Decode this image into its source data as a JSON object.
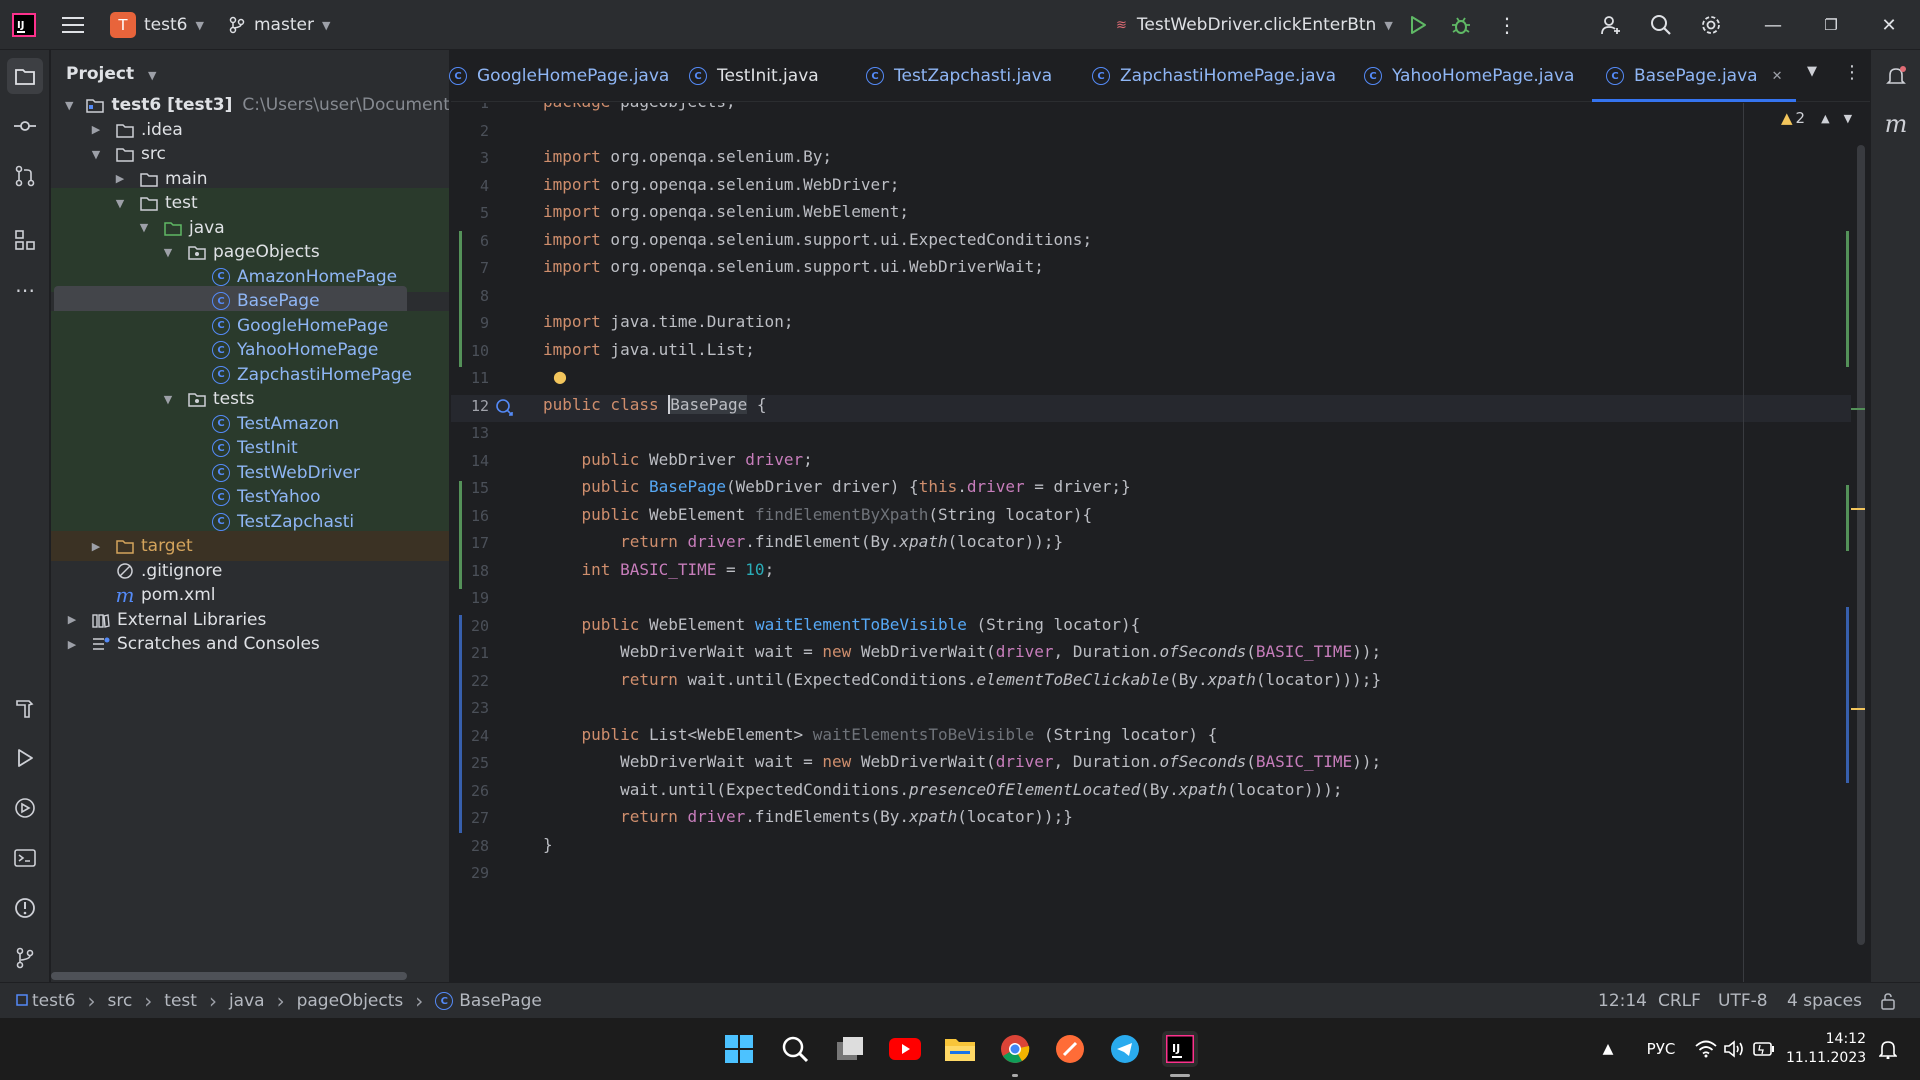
{
  "titlebar": {
    "project_initial": "T",
    "project_name": "test6",
    "branch": "master",
    "run_config": "TestWebDriver.clickEnterBtn"
  },
  "project_panel": {
    "title": "Project",
    "tree": [
      {
        "label": "test6 [test3]",
        "suffix": "C:\\Users\\user\\Documents\\te",
        "type": "module",
        "expanded": true,
        "depth": 0
      },
      {
        "label": ".idea",
        "type": "folder",
        "expanded": false,
        "depth": 1
      },
      {
        "label": "src",
        "type": "folder",
        "expanded": true,
        "depth": 1
      },
      {
        "label": "main",
        "type": "folder",
        "expanded": false,
        "depth": 2
      },
      {
        "label": "test",
        "type": "folder",
        "expanded": true,
        "depth": 2
      },
      {
        "label": "java",
        "type": "folder-green",
        "expanded": true,
        "depth": 3
      },
      {
        "label": "pageObjects",
        "type": "package",
        "expanded": true,
        "depth": 4
      },
      {
        "label": "AmazonHomePage",
        "type": "class",
        "depth": 5
      },
      {
        "label": "BasePage",
        "type": "class",
        "depth": 5,
        "selected": true
      },
      {
        "label": "GoogleHomePage",
        "type": "class",
        "depth": 5
      },
      {
        "label": "YahooHomePage",
        "type": "class",
        "depth": 5
      },
      {
        "label": "ZapchastiHomePage",
        "type": "class",
        "depth": 5
      },
      {
        "label": "tests",
        "type": "package",
        "expanded": true,
        "depth": 4
      },
      {
        "label": "TestAmazon",
        "type": "class",
        "depth": 5
      },
      {
        "label": "TestInit",
        "type": "class",
        "depth": 5
      },
      {
        "label": "TestWebDriver",
        "type": "class",
        "depth": 5
      },
      {
        "label": "TestYahoo",
        "type": "class",
        "depth": 5
      },
      {
        "label": "TestZapchasti",
        "type": "class",
        "depth": 5
      },
      {
        "label": "target",
        "type": "folder-orange",
        "expanded": false,
        "depth": 1
      },
      {
        "label": ".gitignore",
        "type": "ignore",
        "depth": 1
      },
      {
        "label": "pom.xml",
        "type": "maven",
        "depth": 1
      },
      {
        "label": "External Libraries",
        "type": "library",
        "expanded": false,
        "depth": 0
      },
      {
        "label": "Scratches and Consoles",
        "type": "scratch",
        "expanded": false,
        "depth": 0
      }
    ]
  },
  "tabs": [
    {
      "label": "GoogleHomePage.java",
      "active": false
    },
    {
      "label": "TestInit.java",
      "active": false
    },
    {
      "label": "TestZapchasti.java",
      "active": false
    },
    {
      "label": "ZapchastiHomePage.java",
      "active": false
    },
    {
      "label": "YahooHomePage.java",
      "active": false
    },
    {
      "label": "BasePage.java",
      "active": true
    }
  ],
  "editor": {
    "warning_count": "2",
    "lines": [
      [
        [
          "package pageObjects;",
          "kw0"
        ]
      ],
      [],
      [
        [
          "import",
          "kw"
        ],
        [
          " org.openqa.selenium.By;",
          ""
        ]
      ],
      [
        [
          "import",
          "kw"
        ],
        [
          " org.openqa.selenium.WebDriver;",
          ""
        ]
      ],
      [
        [
          "import",
          "kw"
        ],
        [
          " org.openqa.selenium.WebElement;",
          ""
        ]
      ],
      [
        [
          "import",
          "kw"
        ],
        [
          " org.openqa.selenium.support.ui.ExpectedConditions;",
          ""
        ]
      ],
      [
        [
          "import",
          "kw"
        ],
        [
          " org.openqa.selenium.support.ui.WebDriverWait;",
          ""
        ]
      ],
      [],
      [
        [
          "import",
          "kw"
        ],
        [
          " java.time.Duration;",
          ""
        ]
      ],
      [
        [
          "import",
          "kw"
        ],
        [
          " java.util.List;",
          ""
        ]
      ],
      [],
      [
        [
          "public class ",
          "kw"
        ],
        [
          "BasePage",
          ""
        ],
        [
          " {",
          ""
        ]
      ],
      [],
      [
        [
          "    public ",
          "kw"
        ],
        [
          "WebDriver ",
          ""
        ],
        [
          "driver",
          "fld"
        ],
        [
          ";",
          ""
        ]
      ],
      [
        [
          "    public ",
          "kw"
        ],
        [
          "BasePage",
          "mth"
        ],
        [
          "(WebDriver driver) {",
          ""
        ],
        [
          "this",
          "kw"
        ],
        [
          ".",
          ""
        ],
        [
          "driver",
          "fld"
        ],
        [
          " = driver;}",
          ""
        ]
      ],
      [
        [
          "    public ",
          "kw"
        ],
        [
          "WebElement ",
          ""
        ],
        [
          "findElementByXpath",
          "gray"
        ],
        [
          "(String locator){",
          ""
        ]
      ],
      [
        [
          "        return ",
          "kw"
        ],
        [
          "driver",
          "fld"
        ],
        [
          ".findElement(By.",
          ""
        ],
        [
          "xpath",
          "it"
        ],
        [
          "(locator));}",
          ""
        ]
      ],
      [
        [
          "    int ",
          "kw"
        ],
        [
          "BASIC_TIME",
          "fld"
        ],
        [
          " = ",
          ""
        ],
        [
          "10",
          "num"
        ],
        [
          ";",
          ""
        ]
      ],
      [],
      [
        [
          "    public ",
          "kw"
        ],
        [
          "WebElement ",
          ""
        ],
        [
          "waitElementToBeVisible",
          "mth"
        ],
        [
          " (String locator){",
          ""
        ]
      ],
      [
        [
          "        WebDriverWait wait = ",
          ""
        ],
        [
          "new ",
          "kw"
        ],
        [
          "WebDriverWait(",
          ""
        ],
        [
          "driver",
          "fld"
        ],
        [
          ", Duration.",
          ""
        ],
        [
          "ofSeconds",
          "it"
        ],
        [
          "(",
          ""
        ],
        [
          "BASIC_TIME",
          "fld"
        ],
        [
          "));",
          ""
        ]
      ],
      [
        [
          "        return ",
          "kw"
        ],
        [
          "wait.until(ExpectedConditions.",
          ""
        ],
        [
          "elementToBeClickable",
          "it"
        ],
        [
          "(By.",
          ""
        ],
        [
          "xpath",
          "it"
        ],
        [
          "(locator)));}",
          ""
        ]
      ],
      [],
      [
        [
          "    public ",
          "kw"
        ],
        [
          "List<WebElement> ",
          ""
        ],
        [
          "waitElementsToBeVisible",
          "gray"
        ],
        [
          " (String locator) {",
          ""
        ]
      ],
      [
        [
          "        WebDriverWait wait = ",
          ""
        ],
        [
          "new ",
          "kw"
        ],
        [
          "WebDriverWait(",
          ""
        ],
        [
          "driver",
          "fld"
        ],
        [
          ", Duration.",
          ""
        ],
        [
          "ofSeconds",
          "it"
        ],
        [
          "(",
          ""
        ],
        [
          "BASIC_TIME",
          "fld"
        ],
        [
          "));",
          ""
        ]
      ],
      [
        [
          "        wait.until(ExpectedConditions.",
          ""
        ],
        [
          "presenceOfElementLocated",
          "it"
        ],
        [
          "(By.",
          ""
        ],
        [
          "xpath",
          "it"
        ],
        [
          "(locator)));",
          ""
        ]
      ],
      [
        [
          "        return ",
          "kw"
        ],
        [
          "driver",
          "fld"
        ],
        [
          ".findElements(By.",
          ""
        ],
        [
          "xpath",
          "it"
        ],
        [
          "(locator));}",
          ""
        ]
      ],
      [
        [
          "}",
          ""
        ]
      ],
      []
    ]
  },
  "statusbar": {
    "breadcrumb": [
      "test6",
      "src",
      "test",
      "java",
      "pageObjects",
      "BasePage"
    ],
    "position": "12:14",
    "line_sep": "CRLF",
    "encoding": "UTF-8",
    "indent": "4 spaces"
  },
  "taskbar": {
    "lang": "РУС",
    "time": "14:12",
    "date": "11.11.2023"
  },
  "colors": {
    "accent": "#3574f0",
    "bg": "#1e1f22",
    "panel": "#2b2d30"
  }
}
